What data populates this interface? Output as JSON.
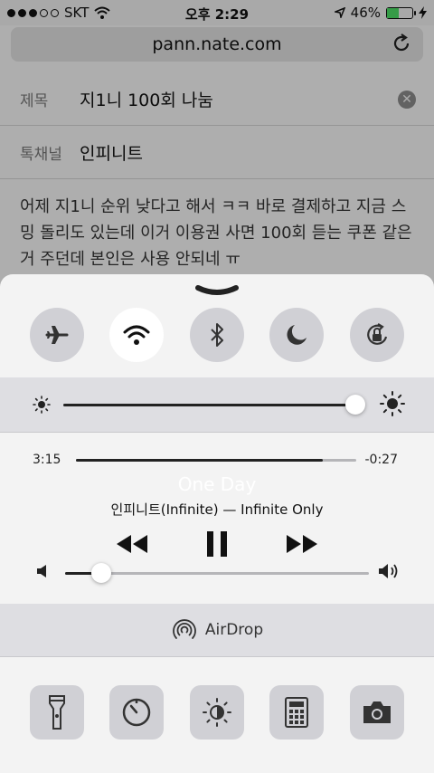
{
  "status_bar": {
    "carrier": "SKT",
    "time": "오후 2:29",
    "battery_percent": "46%",
    "battery_level": 0.46
  },
  "browser": {
    "url": "pann.nate.com"
  },
  "post": {
    "subject_label": "제목",
    "subject_value": "지1니 100회 나눔",
    "channel_label": "톡채널",
    "channel_value": "인피니트",
    "body": "어제 지1니 순위 낮다고 해서 ㅋㅋ 바로 결제하고 지금 스밍 돌리도 있는데 이거 이용권 사면 100회 듣는 쿠폰 같은 거 주던데 본인은 사용 안되네 ㅠ"
  },
  "control_center": {
    "toggles": [
      {
        "icon": "airplane-icon",
        "active": false
      },
      {
        "icon": "wifi-icon",
        "active": true
      },
      {
        "icon": "bluetooth-icon",
        "active": false
      },
      {
        "icon": "moon-icon",
        "active": false
      },
      {
        "icon": "rotation-lock-icon",
        "active": false
      }
    ],
    "brightness": 0.98,
    "music": {
      "elapsed": "3:15",
      "remaining": "-0:27",
      "progress": 0.88,
      "title": "One Day",
      "artist_album": "인피니트(Infinite) — Infinite Only",
      "volume": 0.12
    },
    "airdrop_label": "AirDrop",
    "shortcuts": [
      "flashlight-icon",
      "timer-icon",
      "night-shift-icon",
      "calculator-icon",
      "camera-icon"
    ]
  }
}
